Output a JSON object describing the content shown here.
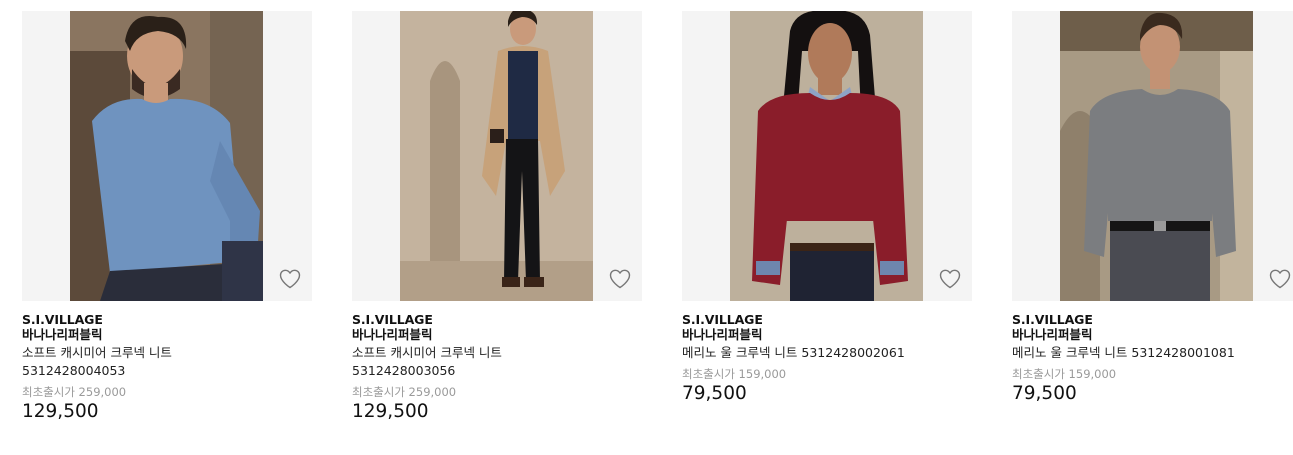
{
  "products": [
    {
      "brand": "S.I.VILLAGE",
      "sub_brand": "바나나리퍼블릭",
      "name_line1": "소프트 캐시미어 크루넥 니트",
      "name_line2": "5312428004053",
      "original_price_label": "최초출시가 259,000",
      "price": "129,500",
      "photo_colors": {
        "bg": "#6b5a48",
        "garment": "#6f93bf",
        "pants": "#2a2d3a",
        "skin": "#c99a7b"
      }
    },
    {
      "brand": "S.I.VILLAGE",
      "sub_brand": "바나나리퍼블릭",
      "name_line1": "소프트 캐시미어 크루넥 니트",
      "name_line2": "5312428003056",
      "original_price_label": "최초출시가 259,000",
      "price": "129,500",
      "photo_colors": {
        "bg": "#b8a48d",
        "garment": "#1f2a44",
        "pants": "#141416",
        "skin": "#c99a7b"
      }
    },
    {
      "brand": "S.I.VILLAGE",
      "sub_brand": "바나나리퍼블릭",
      "name_line1": "메리노 울 크루넥 니트 5312428002061",
      "name_line2": "",
      "original_price_label": "최초출시가 159,000",
      "price": "79,500",
      "photo_colors": {
        "bg": "#b6a995",
        "garment": "#8a1d2a",
        "pants": "#1f2333",
        "skin": "#b07a5a"
      }
    },
    {
      "brand": "S.I.VILLAGE",
      "sub_brand": "바나나리퍼블릭",
      "name_line1": "메리노 울 크루넥 니트 5312428001081",
      "name_line2": "",
      "original_price_label": "최초출시가 159,000",
      "price": "79,500",
      "photo_colors": {
        "bg": "#a99b85",
        "garment": "#7b7d80",
        "pants": "#4a4b52",
        "skin": "#c39274"
      }
    }
  ],
  "icons": {
    "wishlist": "heart-outline-icon"
  }
}
